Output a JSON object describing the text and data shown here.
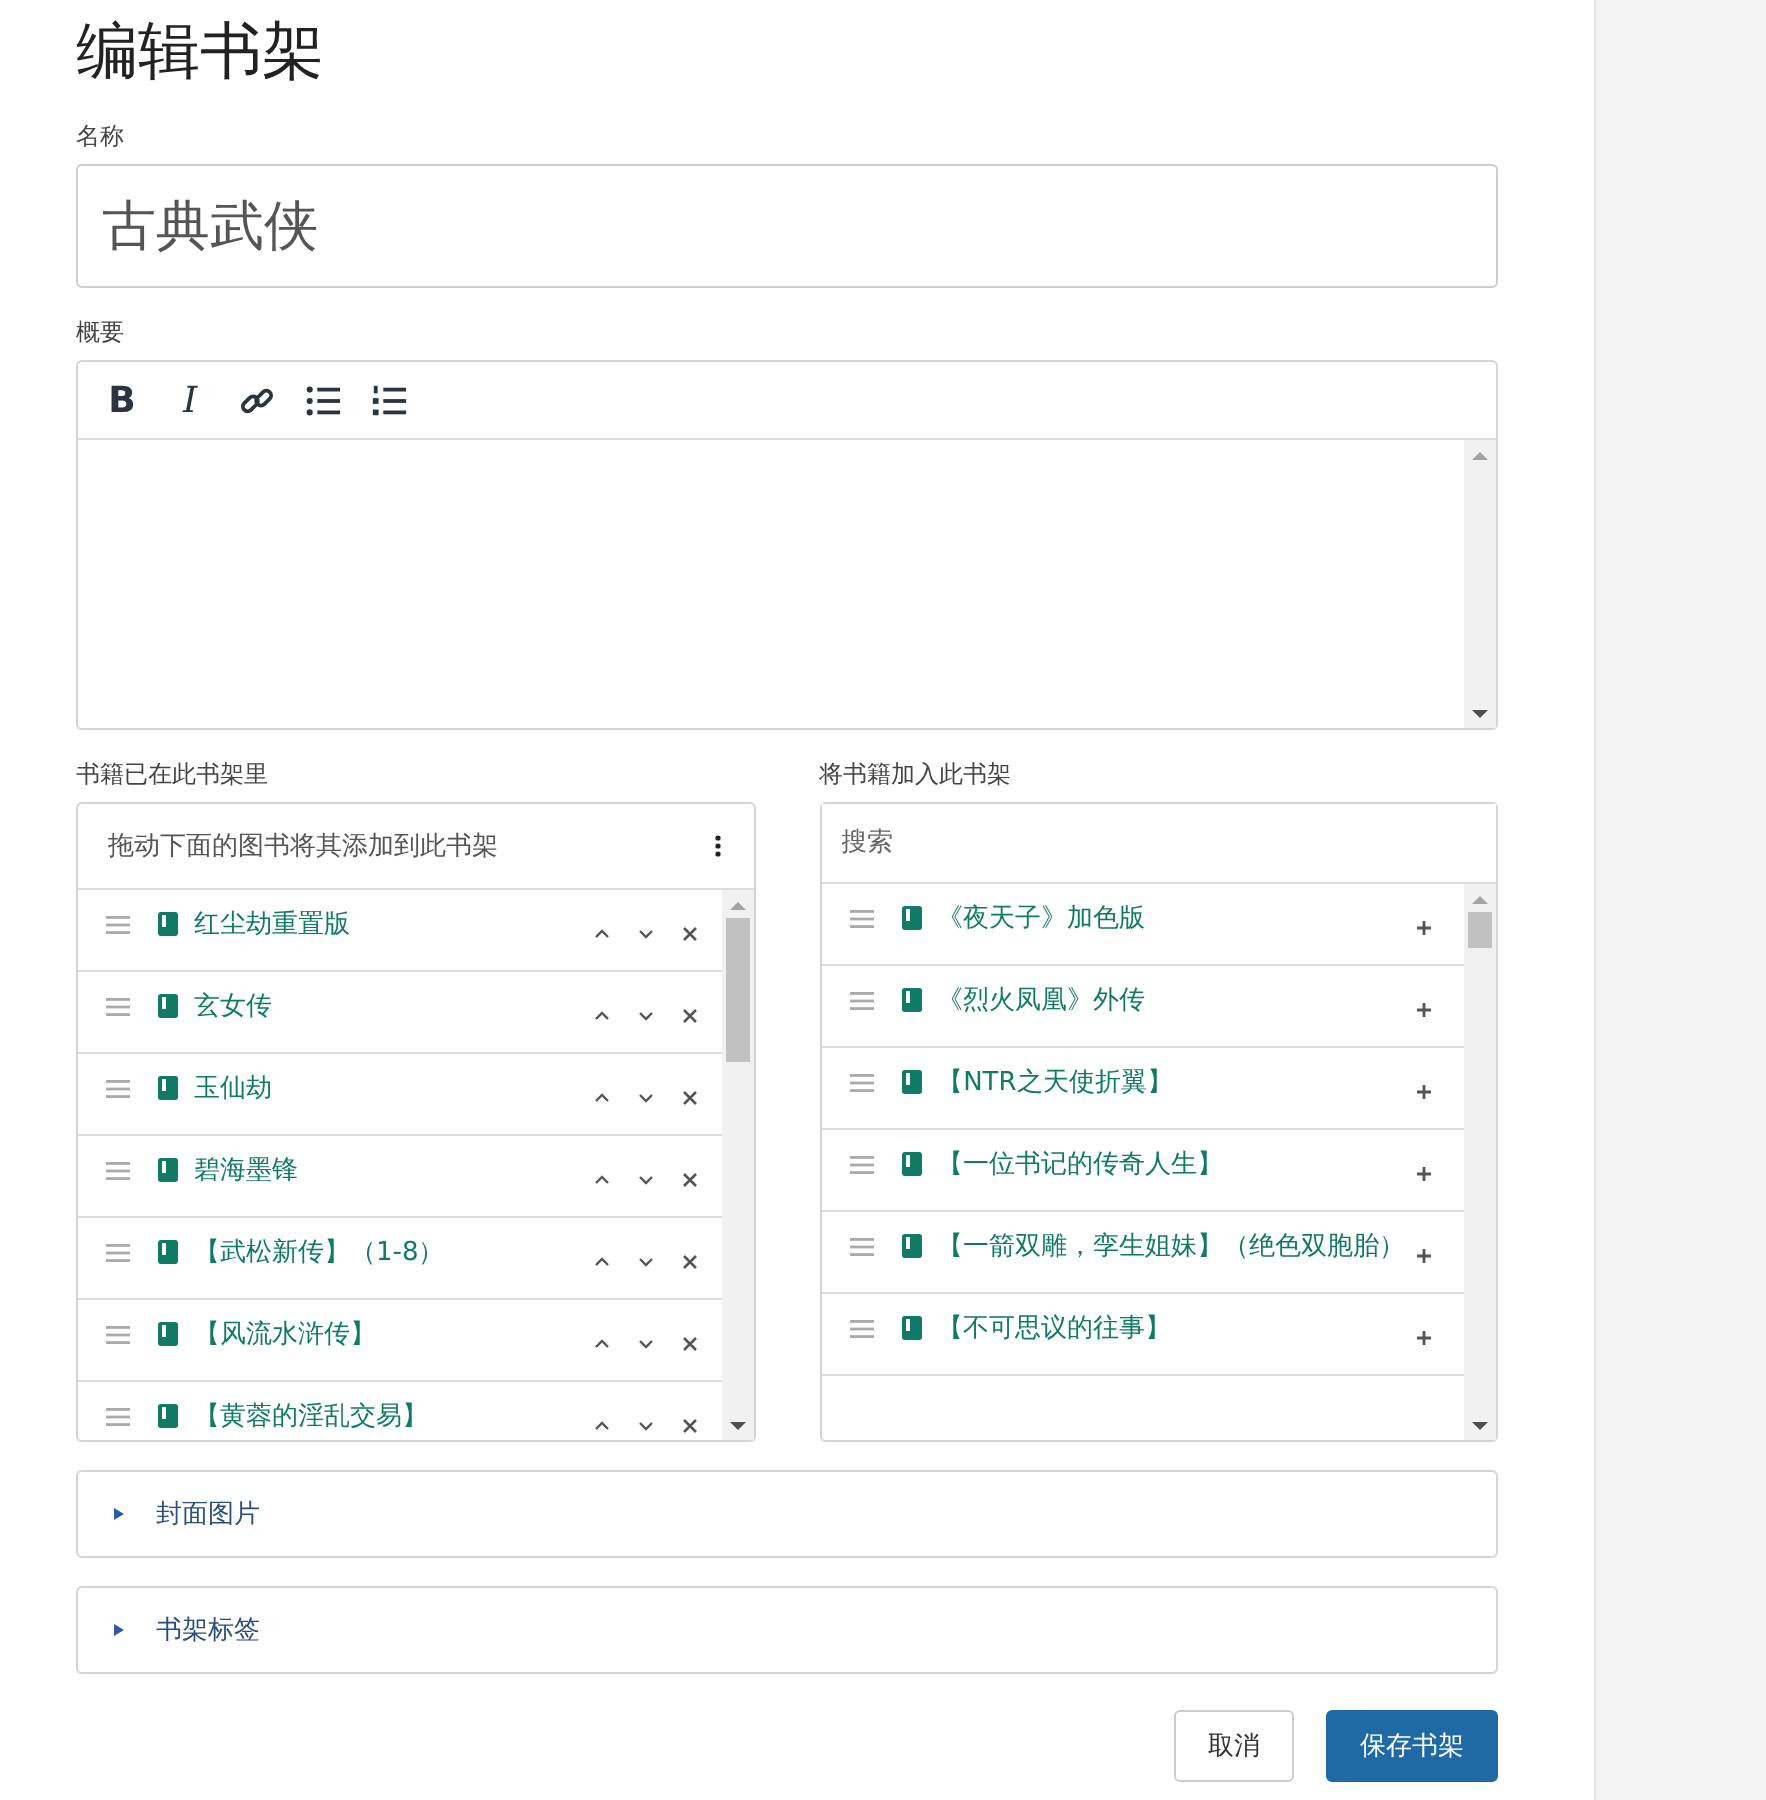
{
  "title": "编辑书架",
  "name_field": {
    "label": "名称",
    "value": "古典武侠"
  },
  "summary": {
    "label": "概要",
    "toolbar": [
      {
        "kind": "bold",
        "label": "B"
      },
      {
        "kind": "italic",
        "label": "I"
      },
      {
        "kind": "link"
      },
      {
        "kind": "bullets"
      },
      {
        "kind": "numbers"
      }
    ]
  },
  "shelf_books": {
    "label": "书籍已在此书架里",
    "hint": "拖动下面的图书将其添加到此书架",
    "items": [
      {
        "title": "红尘劫重置版"
      },
      {
        "title": "玄女传"
      },
      {
        "title": "玉仙劫"
      },
      {
        "title": "碧海墨锋"
      },
      {
        "title": "【武松新传】（1-8）"
      },
      {
        "title": "【风流水浒传】"
      },
      {
        "title": "【黄蓉的淫乱交易】"
      }
    ]
  },
  "add_books": {
    "label": "将书籍加入此书架",
    "search": {
      "placeholder": "搜索"
    },
    "items": [
      {
        "title": "《夜天子》加色版"
      },
      {
        "title": "《烈火凤凰》外传"
      },
      {
        "title": "【NTR之天使折翼】"
      },
      {
        "title": "【一位书记的传奇人生】"
      },
      {
        "title": "【一箭双雕，孪生姐妹】（绝色双胞胎）"
      },
      {
        "title": "【不可思议的往事】"
      }
    ]
  },
  "sections": [
    {
      "label": "封面图片",
      "expanded": false
    },
    {
      "label": "书架标签",
      "expanded": false
    }
  ],
  "buttons": [
    {
      "kind": "secondary",
      "label": "取消"
    },
    {
      "kind": "primary",
      "label": "保存书架"
    }
  ]
}
